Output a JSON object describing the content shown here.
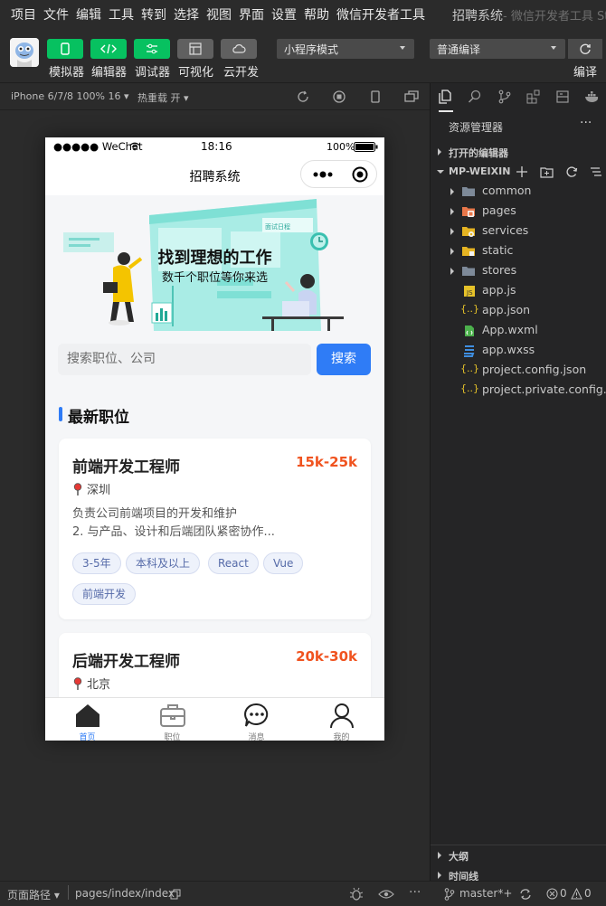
{
  "menubar": {
    "items": [
      "项目",
      "文件",
      "编辑",
      "工具",
      "转到",
      "选择",
      "视图",
      "界面",
      "设置",
      "帮助",
      "微信开发者工具"
    ],
    "app_title": "招聘系统",
    "app_subtitle": "- 微信开发者工具 Sta"
  },
  "toolbar": {
    "buttons": [
      {
        "label": "模拟器",
        "icon": "phone-icon",
        "color": "#07c160"
      },
      {
        "label": "编辑器",
        "icon": "code-icon",
        "color": "#07c160"
      },
      {
        "label": "调试器",
        "icon": "debug-icon",
        "color": "#07c160"
      },
      {
        "label": "可视化",
        "icon": "layout-icon",
        "color": "#606060"
      },
      {
        "label": "云开发",
        "icon": "cloud-icon",
        "color": "#606060"
      }
    ],
    "mode_select": "小程序模式",
    "compile_select": "普通编译",
    "compile_label": "编译"
  },
  "simulator": {
    "device": "iPhone 6/7/8 100% 16",
    "hot_reload": "热重载 开"
  },
  "phone": {
    "status": {
      "carrier": "●●●●● WeChat",
      "time": "18:16",
      "battery": "100%"
    },
    "nav_title": "招聘系统",
    "banner": {
      "title": "找到理想的工作",
      "subtitle": "数千个职位等你来选",
      "screen_tag": "面试日程"
    },
    "search": {
      "placeholder": "搜索职位、公司",
      "button": "搜索"
    },
    "section_title": "最新职位",
    "jobs": [
      {
        "title": "前端开发工程师",
        "salary": "15k-25k",
        "location": "深圳",
        "desc_line1": "负责公司前端项目的开发和维护",
        "desc_line2": "2. 与产品、设计和后端团队紧密协作...",
        "tags": [
          "3-5年",
          "本科及以上",
          "React",
          "Vue",
          "前端开发"
        ]
      },
      {
        "title": "后端开发工程师",
        "salary": "20k-30k",
        "location": "北京"
      }
    ],
    "tabbar": [
      {
        "label": "首页",
        "icon": "home-icon",
        "active": true
      },
      {
        "label": "职位",
        "icon": "briefcase-icon",
        "active": false
      },
      {
        "label": "消息",
        "icon": "chat-icon",
        "active": false
      },
      {
        "label": "我的",
        "icon": "user-icon",
        "active": false
      }
    ],
    "accent": "#2f7cf6",
    "salary_color": "#f0531f"
  },
  "explorer": {
    "title": "资源管理器",
    "open_editors": "打开的编辑器",
    "project": "MP-WEIXIN",
    "tree": [
      {
        "name": "common",
        "type": "folder",
        "icon": "folder-icon"
      },
      {
        "name": "pages",
        "type": "folder",
        "icon": "folder-pages-icon"
      },
      {
        "name": "services",
        "type": "folder",
        "icon": "folder-services-icon"
      },
      {
        "name": "static",
        "type": "folder",
        "icon": "folder-static-icon"
      },
      {
        "name": "stores",
        "type": "folder",
        "icon": "folder-icon"
      },
      {
        "name": "app.js",
        "type": "file",
        "icon": "js-file-icon"
      },
      {
        "name": "app.json",
        "type": "file",
        "icon": "json-file-icon"
      },
      {
        "name": "App.wxml",
        "type": "file",
        "icon": "wxml-file-icon"
      },
      {
        "name": "app.wxss",
        "type": "file",
        "icon": "wxss-file-icon"
      },
      {
        "name": "project.config.json",
        "type": "file",
        "icon": "json-file-icon"
      },
      {
        "name": "project.private.config.js...",
        "type": "file",
        "icon": "json-file-icon"
      }
    ],
    "outline": "大纲",
    "timeline": "时间线"
  },
  "bottombar": {
    "page_path_label": "页面路径",
    "page_path": "pages/index/index",
    "branch": "master*+",
    "errors": "0",
    "warnings": "0"
  }
}
